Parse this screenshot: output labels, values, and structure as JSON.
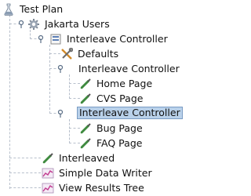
{
  "tree": {
    "test_plan": "Test Plan",
    "jakarta_users": "Jakarta Users",
    "interleave_controller_1": "Interleave Controller",
    "defaults": "Defaults",
    "interleave_controller_2": "Interleave Controller",
    "home_page": "Home Page",
    "cvs_page": "CVS Page",
    "interleave_controller_3": "Interleave Controller",
    "bug_page": "Bug Page",
    "faq_page": "FAQ Page",
    "interleaved": "Interleaved",
    "simple_data_writer": "Simple Data Writer",
    "view_results_tree": "View Results Tree"
  },
  "selected_node": "interleave_controller_3",
  "colors": {
    "selection_bg": "#b9d1ea",
    "selection_border": "#7a9cc4"
  }
}
